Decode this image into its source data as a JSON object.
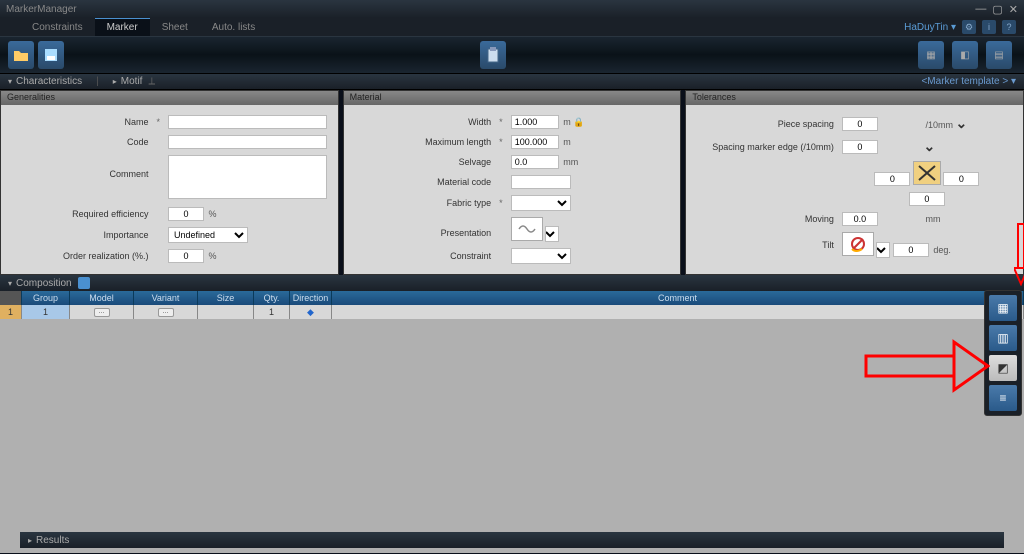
{
  "titlebar": {
    "title": "MarkerManager"
  },
  "tabs": {
    "constraints": "Constraints",
    "marker": "Marker",
    "sheet": "Sheet",
    "autolists": "Auto. lists"
  },
  "user": {
    "name": "HaDuyTin"
  },
  "section": {
    "characteristics": "Characteristics",
    "motif": "Motif",
    "template": "<Marker template >"
  },
  "generalities": {
    "title": "Generalities",
    "name": "Name",
    "name_val": "",
    "code": "Code",
    "code_val": "",
    "comment": "Comment",
    "comment_val": "",
    "req_eff": "Required efficiency",
    "req_eff_val": "0",
    "pct": "%",
    "importance": "Importance",
    "importance_val": "Undefined",
    "order_real": "Order realization (%.)",
    "order_real_val": "0"
  },
  "material": {
    "title": "Material",
    "width": "Width",
    "width_val": "1.000",
    "width_unit": "m",
    "maxlen": "Maximum length",
    "maxlen_val": "100.000",
    "maxlen_unit": "m",
    "selvage": "Selvage",
    "selvage_val": "0.0",
    "selvage_unit": "mm",
    "matcode": "Material code",
    "matcode_val": "",
    "fabrictype": "Fabric type",
    "fabrictype_val": "",
    "presentation": "Presentation",
    "constraint": "Constraint",
    "constraint_val": ""
  },
  "tolerances": {
    "title": "Tolerances",
    "piece_spacing": "Piece spacing",
    "piece_spacing_val": "0",
    "piece_spacing_unit": "/10mm",
    "spacing_edge": "Spacing marker edge (/10mm)",
    "spacing_edge_val": "0",
    "left_val": "0",
    "right_val": "0",
    "bottom_val": "0",
    "moving": "Moving",
    "moving_val": "0.0",
    "moving_unit": "mm",
    "tilt": "Tilt",
    "tilt_val": "0",
    "tilt_unit": "deg."
  },
  "composition": {
    "title": "Composition",
    "headers": {
      "group": "Group",
      "model": "Model",
      "variant": "Variant",
      "size": "Size",
      "qty": "Qty.",
      "direction": "Direction",
      "comment": "Comment"
    },
    "row1": {
      "num": "1",
      "group": "1",
      "qty": "1"
    }
  },
  "results": {
    "title": "Results"
  }
}
